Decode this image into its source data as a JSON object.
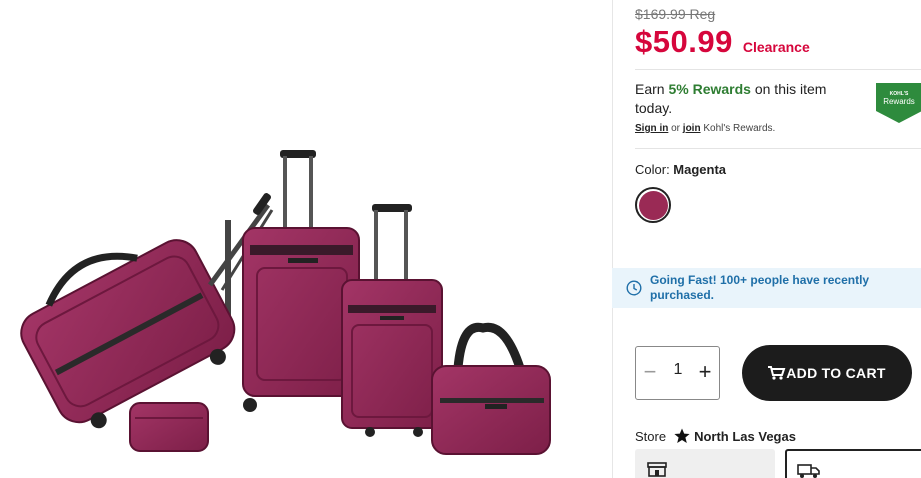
{
  "product": {
    "image_alt": "Magenta luggage set",
    "reg_price": "$169.99 Reg",
    "sale_price": "$50.99",
    "sale_tag": "Clearance"
  },
  "rewards": {
    "earn_prefix": "Earn ",
    "earn_highlight": "5% Rewards",
    "earn_suffix": " on this item today.",
    "signin_link": "Sign in",
    "or_text": " or ",
    "join_link": "join",
    "suffix_text": " Kohl's Rewards.",
    "badge_top": "KOHL'S",
    "badge_bottom": "Rewards",
    "badge_color": "#2e8b3d"
  },
  "color": {
    "label": "Color: ",
    "value": "Magenta",
    "swatch_hex": "#9a2a55"
  },
  "urgency": {
    "text": "Going Fast! 100+ people have recently purchased.",
    "icon": "clock-icon"
  },
  "quantity": {
    "minus": "−",
    "value": "1",
    "plus": "+"
  },
  "cart": {
    "label": "ADD TO CART",
    "icon": "cart-icon"
  },
  "store": {
    "label": "Store",
    "name": "North Las Vegas",
    "icon": "star-icon"
  },
  "fulfillment": {
    "pickup_icon": "store-icon",
    "ship_icon": "truck-icon"
  },
  "colors": {
    "sale_red": "#d6063c",
    "rewards_green": "#2e7d32",
    "banner_bg": "#e9f4fb",
    "banner_text": "#1f6fa8",
    "button_bg": "#1c1c1c"
  }
}
